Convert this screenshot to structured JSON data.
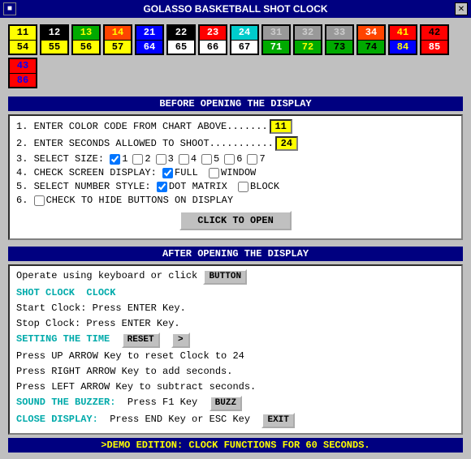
{
  "titleBar": {
    "title": "GOLASSO BASKETBALL SHOT CLOCK",
    "icon": "■",
    "closeBtn": "✕"
  },
  "colorChart": [
    {
      "top": "11",
      "bot": "54",
      "topBg": "#ffff00",
      "botBg": "#ffff00",
      "border": "#000"
    },
    {
      "top": "12",
      "bot": "55",
      "topBg": "#000000",
      "botBg": "#ffff00",
      "topColor": "#ffffff",
      "botColor": "#000000",
      "border": "#000"
    },
    {
      "top": "13",
      "bot": "56",
      "topBg": "#00aa00",
      "botBg": "#ffff00",
      "topColor": "#ffff00",
      "border": "#000"
    },
    {
      "top": "14",
      "bot": "57",
      "topBg": "#ff4400",
      "botBg": "#ffff00",
      "topColor": "#ffff00",
      "border": "#000"
    },
    {
      "top": "21",
      "bot": "64",
      "topBg": "#0000ff",
      "botBg": "#0000ff",
      "topColor": "#ffffff",
      "botColor": "#ffffff",
      "border": "#000"
    },
    {
      "top": "22",
      "bot": "65",
      "topBg": "#000000",
      "botBg": "#ffffff",
      "topColor": "#ffffff",
      "border": "#000"
    },
    {
      "top": "23",
      "bot": "66",
      "topBg": "#ff0000",
      "botBg": "#ffffff",
      "topColor": "#ffffff",
      "border": "#000"
    },
    {
      "top": "24",
      "bot": "67",
      "topBg": "#00cccc",
      "botBg": "#ffffff",
      "topColor": "#ffffff",
      "border": "#000"
    },
    {
      "top": "31",
      "bot": "71",
      "topBg": "#999999",
      "botBg": "#00aa00",
      "topColor": "#cccccc",
      "botColor": "#ffffff",
      "border": "#000"
    },
    {
      "top": "32",
      "bot": "72",
      "topBg": "#999999",
      "botBg": "#00aa00",
      "topColor": "#cccccc",
      "botColor": "#ffff00",
      "border": "#000"
    },
    {
      "top": "33",
      "bot": "73",
      "topBg": "#999999",
      "botBg": "#00aa00",
      "topColor": "#cccccc",
      "botColor": "#000000",
      "border": "#000"
    },
    {
      "top": "34",
      "bot": "74",
      "topBg": "#ff4400",
      "botBg": "#00aa00",
      "topColor": "#ffffff",
      "botColor": "#000000",
      "border": "#000"
    },
    {
      "top": "41",
      "bot": "84",
      "topBg": "#ff0000",
      "botBg": "#0000ff",
      "topColor": "#ffff00",
      "botColor": "#ffff00",
      "border": "#000"
    },
    {
      "top": "42",
      "bot": "85",
      "topBg": "#ff0000",
      "botBg": "#ff0000",
      "topColor": "#000000",
      "botColor": "#ffffff",
      "border": "#000"
    },
    {
      "top": "43",
      "bot": "86",
      "topBg": "#ff0000",
      "botBg": "#ff0000",
      "topColor": "#0000ff",
      "botColor": "#0000ff",
      "border": "#000"
    }
  ],
  "beforeSection": {
    "header": "BEFORE OPENING THE DISPLAY",
    "step1Label": "1. ENTER COLOR CODE FROM CHART ABOVE.......",
    "step1Value": "11",
    "step2Label": "2. ENTER SECONDS ALLOWED TO SHOOT...........",
    "step2Value": "24",
    "step3Label": "3. SELECT SIZE:",
    "step3Sizes": [
      "1",
      "2",
      "3",
      "4",
      "5",
      "6",
      "7"
    ],
    "step4Label": "4. CHECK SCREEN DISPLAY:",
    "step4Options": [
      "FULL",
      "WINDOW"
    ],
    "step5Label": "5. SELECT NUMBER STYLE:",
    "step5Options": [
      "DOT MATRIX",
      "BLOCK"
    ],
    "step6Label": "6.",
    "step6CheckLabel": "CHECK TO HIDE BUTTONS ON DISPLAY",
    "openBtn": "CLICK TO OPEN"
  },
  "afterSection": {
    "header": "AFTER OPENING THE DISPLAY",
    "line1a": "Operate using keyboard or click ",
    "line1btn": "BUTTON",
    "line1b": "",
    "shotClockLabel": "SHOT CLOCK",
    "clockLabel": "CLOCK",
    "line2": "Start Clock: Press ENTER Key.",
    "line3": "Stop Clock: Press ENTER Key.",
    "settingLabel": "SETTING THE TIME",
    "resetLabel": "RESET",
    "line4": "Press UP ARROW Key to reset Clock to 24",
    "line5": "Press RIGHT ARROW Key to add seconds.",
    "line6": "Press LEFT ARROW Key to subtract seconds.",
    "soundBuzzerLabel": "SOUND THE BUZZER:",
    "soundBuzzerText": "Press F1 Key",
    "buzzLabel": "BUZZ",
    "closeDisplayLabel": "CLOSE DISPLAY:",
    "closeDisplayText": "Press END Key or ESC Key",
    "exitLabel": "EXIT"
  },
  "demoBar": {
    "text": ">DEMO EDITION: CLOCK FUNCTIONS FOR 60 SECONDS."
  }
}
